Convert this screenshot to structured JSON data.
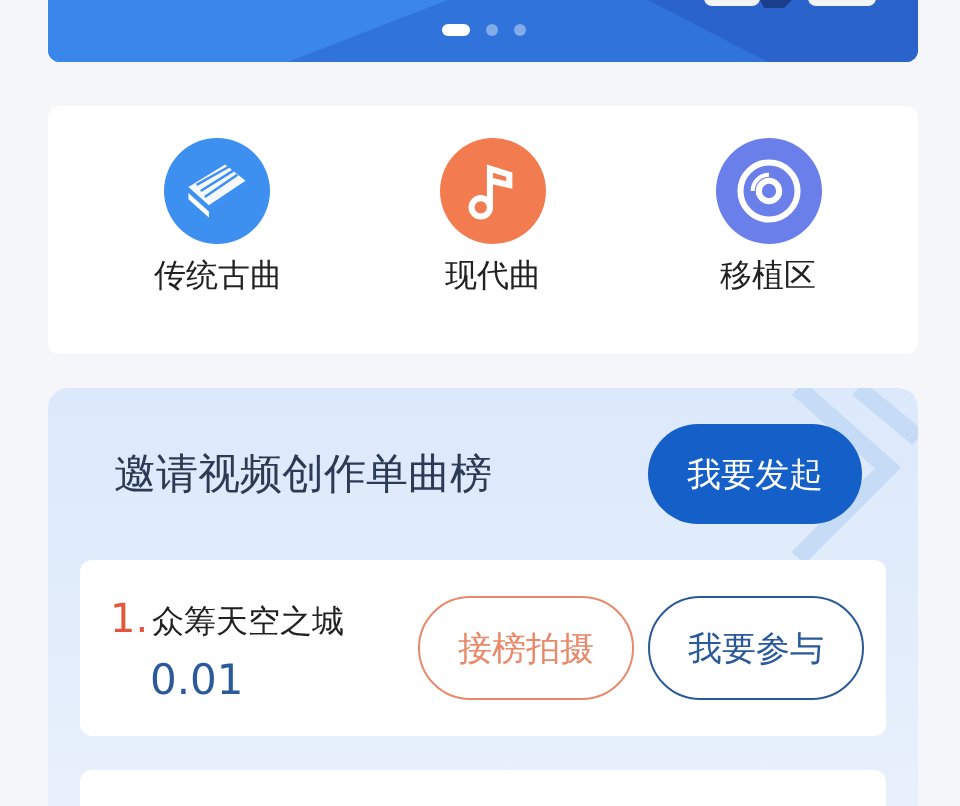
{
  "banner": {
    "kind": "picture",
    "dots": [
      {
        "selected": true
      },
      {
        "selected": false
      },
      {
        "selected": false
      }
    ]
  },
  "categories": [
    {
      "label": "传统古曲",
      "color": "#3d8ff0",
      "kind": "zither"
    },
    {
      "label": "现代曲",
      "color": "#f27c4f",
      "kind": "note"
    },
    {
      "label": "移植区",
      "color": "#6a7fea",
      "kind": "disc"
    }
  ],
  "ranking": {
    "title": "邀请视频创作单曲榜",
    "action": "我要发起",
    "items": [
      {
        "rank": "1.",
        "name": "众筹天空之城",
        "amount": "0.01",
        "buttons": [
          "接榜拍摄",
          "我要参与"
        ]
      }
    ]
  }
}
